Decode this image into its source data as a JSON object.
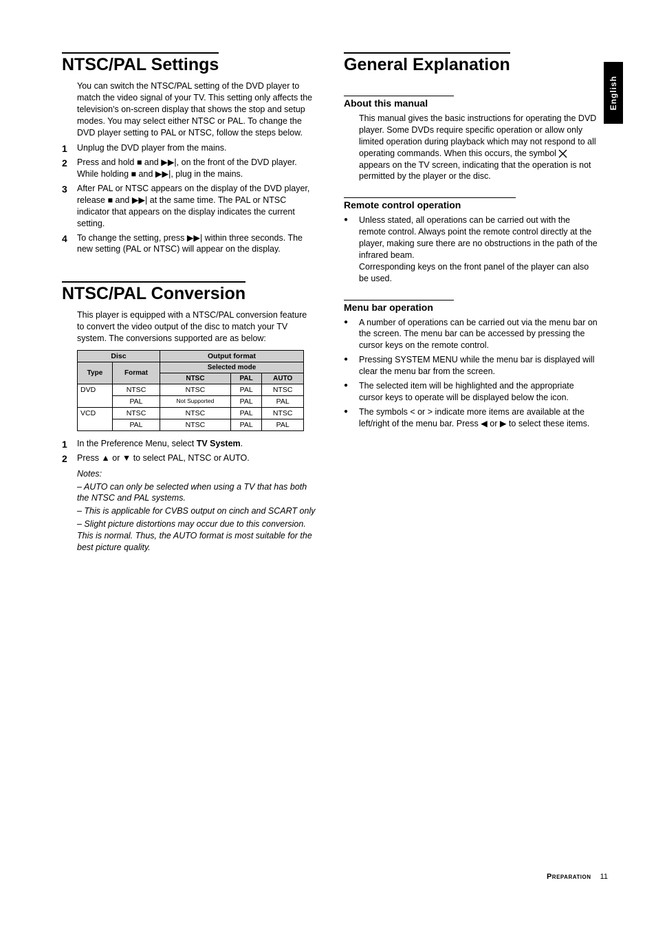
{
  "language_tab": "English",
  "left": {
    "sec1_title": "NTSC/PAL Settings",
    "sec1_body": "You can switch the NTSC/PAL setting of the DVD player to match the video signal of your TV. This setting only affects the television's on-screen display that shows the stop and setup modes. You may select either NTSC or PAL. To change the DVD player setting to PAL or NTSC, follow the steps below.",
    "sec1_steps": [
      "Unplug the DVD player from the mains.",
      "Press and hold ■ and ▶▶|, on the front of the DVD player. While holding ■ and ▶▶|, plug in the mains.",
      "After PAL or NTSC appears on the display of the DVD player, release ■ and ▶▶| at the same time. The PAL or NTSC indicator that appears on the display indicates the current setting.",
      "To change the setting, press ▶▶| within three seconds. The new setting (PAL or NTSC) will appear on the display."
    ],
    "sec2_title": "NTSC/PAL Conversion",
    "sec2_body": "This player is equipped with a NTSC/PAL conversion feature to convert the video output of the disc to match your TV system. The conversions supported are as below:",
    "table": {
      "head_disc": "Disc",
      "head_output": "Output format",
      "head_type": "Type",
      "head_format": "Format",
      "head_selected": "Selected mode",
      "mode_ntsc": "NTSC",
      "mode_pal": "PAL",
      "mode_auto": "AUTO",
      "rows": [
        {
          "type": "DVD",
          "format": "NTSC",
          "ntsc": "NTSC",
          "pal": "PAL",
          "auto": "NTSC"
        },
        {
          "type": "",
          "format": "PAL",
          "ntsc": "Not Supported",
          "pal": "PAL",
          "auto": "PAL"
        },
        {
          "type": "VCD",
          "format": "NTSC",
          "ntsc": "NTSC",
          "pal": "PAL",
          "auto": "NTSC"
        },
        {
          "type": "",
          "format": "PAL",
          "ntsc": "NTSC",
          "pal": "PAL",
          "auto": "PAL"
        }
      ]
    },
    "sec2_steps": {
      "s1_pre": "In the Preference Menu, select ",
      "s1_bold": "TV System",
      "s1_post": ".",
      "s2": "Press ▲ or ▼ to select PAL, NTSC or AUTO."
    },
    "notes_label": "Notes:",
    "notes": [
      "–   AUTO can only be selected when using a TV that has both the NTSC and PAL systems.",
      "–   This is applicable for CVBS output on cinch and SCART only",
      "–   Slight picture distortions may occur due to this conversion. This is normal. Thus, the AUTO format is most suitable for the best picture quality."
    ]
  },
  "right": {
    "sec_title": "General Explanation",
    "sub1_title": "About this manual",
    "sub1_body_a": "This manual gives the basic instructions for operating the DVD player. Some DVDs require specific operation or allow only limited operation during playback which may not respond to all operating commands. When this occurs, the symbol ",
    "sub1_body_b": " appears on the TV screen, indicating that the operation is not permitted by the player or the disc.",
    "sub2_title": "Remote control operation",
    "sub2_items": [
      "Unless stated, all operations can be carried out with the remote control. Always point the remote control directly at the player, making sure there are no obstructions in the path of the infrared beam.\nCorresponding keys on the front panel of the player can also be used."
    ],
    "sub3_title": "Menu bar operation",
    "sub3_items": [
      "A number of operations can be carried out via the menu bar on the screen. The menu bar can be accessed by pressing the cursor keys on the remote control.",
      "Pressing SYSTEM MENU while the menu bar is displayed will clear the menu bar from the screen.",
      "The selected item will be highlighted and the appropriate cursor keys to operate will be displayed below the icon.",
      "The symbols < or > indicate more items are available at the left/right of the menu bar. Press ◀ or ▶ to select these items."
    ]
  },
  "footer_label": "Preparation",
  "footer_page": "11"
}
